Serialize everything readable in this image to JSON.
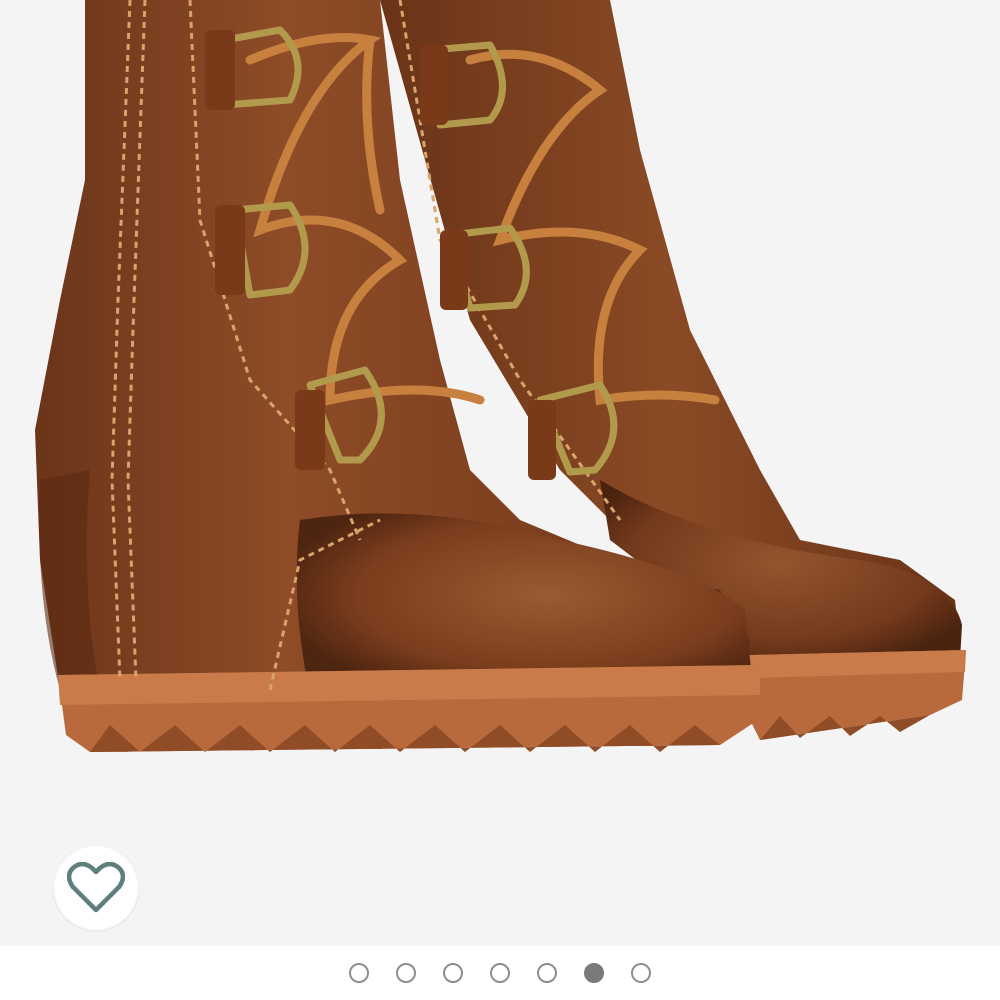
{
  "product_image": {
    "subject": "boots-photo",
    "background": "#f4f4f4",
    "leather": "#8a4a26",
    "sole": "#b86a3c"
  },
  "like_button": {
    "icon": "heart-outline-icon",
    "icon_color": "#5f7f7f"
  },
  "carousel": {
    "total": 7,
    "active_index": 5
  }
}
